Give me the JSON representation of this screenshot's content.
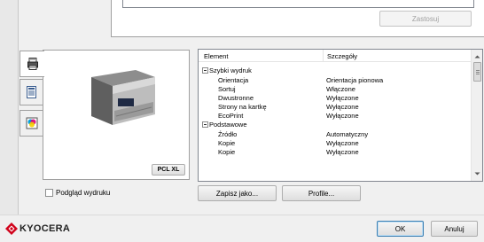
{
  "top": {
    "apply_label": "Zastosuj"
  },
  "tabs": [
    {
      "icon": "printer-settings-icon"
    },
    {
      "icon": "document-icon"
    },
    {
      "icon": "color-icon"
    }
  ],
  "preview": {
    "pcl_label": "PCL XL"
  },
  "list": {
    "col_element": "Element",
    "col_details": "Szczegóły",
    "rows": [
      {
        "name": "Szybki wydruk",
        "value": "",
        "group": true
      },
      {
        "name": "Orientacja",
        "value": "Orientacja pionowa",
        "group": false
      },
      {
        "name": "Sortuj",
        "value": "Włączone",
        "group": false
      },
      {
        "name": "Dwustronne",
        "value": "Wyłączone",
        "group": false
      },
      {
        "name": "Strony na kartkę",
        "value": "Wyłączone",
        "group": false
      },
      {
        "name": "EcoPrint",
        "value": "Wyłączone",
        "group": false
      },
      {
        "name": "Podstawowe",
        "value": "",
        "group": true
      },
      {
        "name": "Źródło",
        "value": "Automatyczny",
        "group": false
      },
      {
        "name": "Kopie",
        "value": "Wyłączone",
        "group": false
      },
      {
        "name": "Kopie",
        "value": "Wyłączone",
        "group": false
      }
    ]
  },
  "preview_checkbox": {
    "label": "Podgląd wydruku"
  },
  "buttons": {
    "save_as": "Zapisz jako...",
    "profile": "Profile...",
    "ok": "OK",
    "cancel": "Anuluj"
  },
  "brand": {
    "name": "KYOCERA",
    "color": "#d0021b"
  }
}
